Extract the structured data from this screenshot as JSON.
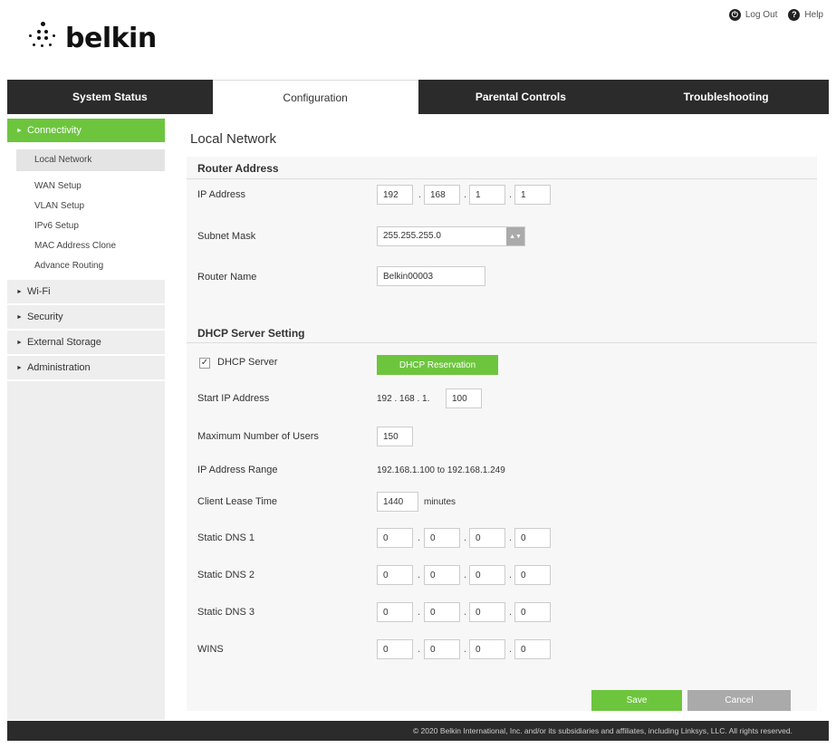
{
  "header": {
    "logout_label": "Log Out",
    "help_label": "Help",
    "logo_text": "belkin"
  },
  "nav": {
    "tabs": [
      {
        "label": "System Status"
      },
      {
        "label": "Configuration"
      },
      {
        "label": "Parental Controls"
      },
      {
        "label": "Troubleshooting"
      }
    ],
    "active_tab": "Configuration"
  },
  "sidebar": {
    "connectivity": "Connectivity",
    "sub_items": [
      {
        "label": "Local Network"
      },
      {
        "label": "WAN Setup"
      },
      {
        "label": "VLAN Setup"
      },
      {
        "label": "IPv6 Setup"
      },
      {
        "label": "MAC Address Clone"
      },
      {
        "label": "Advance Routing"
      }
    ],
    "sections": [
      {
        "label": "Wi-Fi"
      },
      {
        "label": "Security"
      },
      {
        "label": "External Storage"
      },
      {
        "label": "Administration"
      }
    ]
  },
  "page": {
    "title": "Local Network",
    "router_address": {
      "heading": "Router Address",
      "ip_label": "IP Address",
      "ip": [
        "192",
        "168",
        "1",
        "1"
      ],
      "subnet_label": "Subnet Mask",
      "subnet_value": "255.255.255.0",
      "router_name_label": "Router Name",
      "router_name_value": "Belkin00003"
    },
    "dhcp": {
      "heading": "DHCP Server Setting",
      "server_label": "DHCP Server",
      "server_checked": true,
      "reservation_button": "DHCP Reservation",
      "start_ip_label": "Start IP Address",
      "start_ip_prefix": "192 . 168 . 1.",
      "start_ip_last": "100",
      "max_users_label": "Maximum Number of Users",
      "max_users_value": "150",
      "range_label": "IP Address Range",
      "range_value": "192.168.1.100 to 192.168.1.249",
      "lease_label": "Client Lease Time",
      "lease_value": "1440",
      "lease_unit": "minutes",
      "dns1_label": "Static DNS 1",
      "dns1": [
        "0",
        "0",
        "0",
        "0"
      ],
      "dns2_label": "Static DNS 2",
      "dns2": [
        "0",
        "0",
        "0",
        "0"
      ],
      "dns3_label": "Static DNS 3",
      "dns3": [
        "0",
        "0",
        "0",
        "0"
      ],
      "wins_label": "WINS",
      "wins": [
        "0",
        "0",
        "0",
        "0"
      ]
    },
    "save_label": "Save",
    "cancel_label": "Cancel"
  },
  "footer": {
    "text": "© 2020 Belkin International, Inc. and/or its subsidiaries and affiliates, including Linksys, LLC. All rights reserved."
  },
  "colors": {
    "accent_green": "#6dc53e",
    "nav_dark": "#2b2b2b",
    "cancel_grey": "#aaaaaa"
  }
}
